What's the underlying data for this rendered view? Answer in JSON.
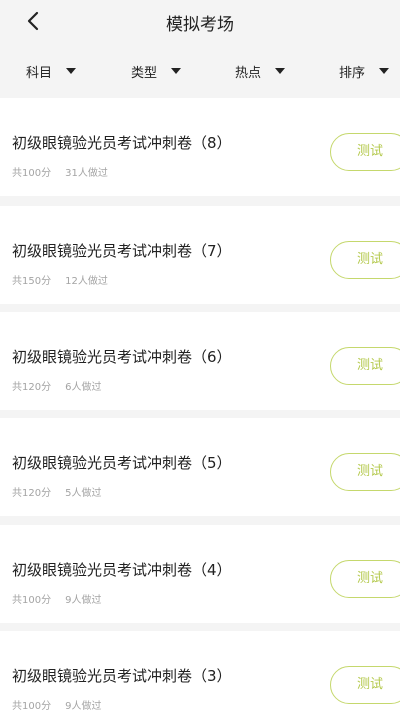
{
  "header": {
    "title": "模拟考场"
  },
  "filters": [
    {
      "label": "科目"
    },
    {
      "label": "类型"
    },
    {
      "label": "热点"
    },
    {
      "label": "排序"
    }
  ],
  "exams": [
    {
      "title": "初级眼镜验光员考试冲刺卷（8）",
      "score": "共100分",
      "participants": "31人做过",
      "button": "测试"
    },
    {
      "title": "初级眼镜验光员考试冲刺卷（7）",
      "score": "共150分",
      "participants": "12人做过",
      "button": "测试"
    },
    {
      "title": "初级眼镜验光员考试冲刺卷（6）",
      "score": "共120分",
      "participants": "6人做过",
      "button": "测试"
    },
    {
      "title": "初级眼镜验光员考试冲刺卷（5）",
      "score": "共120分",
      "participants": "5人做过",
      "button": "测试"
    },
    {
      "title": "初级眼镜验光员考试冲刺卷（4）",
      "score": "共100分",
      "participants": "9人做过",
      "button": "测试"
    },
    {
      "title": "初级眼镜验光员考试冲刺卷（3）",
      "score": "共100分",
      "participants": "9人做过",
      "button": "测试"
    }
  ],
  "colors": {
    "accent": "#c5d86d",
    "accent_text": "#b4c94d",
    "meta_text": "#a4a4a4",
    "background": "#f4f4f4"
  },
  "icons": {
    "back": "chevron-left-icon",
    "filter_caret": "caret-down-icon"
  }
}
